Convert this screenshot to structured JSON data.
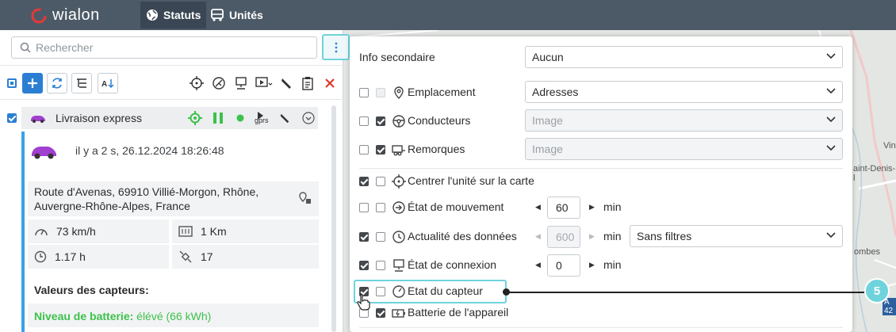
{
  "topbar": {
    "logo_text": "wialon",
    "tabs": [
      {
        "label": "Statuts",
        "icon": "globe-icon",
        "active": true
      },
      {
        "label": "Unités",
        "icon": "bus-icon",
        "active": false
      }
    ]
  },
  "search": {
    "placeholder": "Rechercher"
  },
  "unit": {
    "name": "Livraison express",
    "last_update": "il y a 2 s, 26.12.2024 18:26:48",
    "address_line1": "Route d'Avenas, 69910 Villié-Morgon, Rhône,",
    "address_line2": "Auvergne-Rhône-Alpes, France",
    "speed": "73 km/h",
    "mileage": "1 Km",
    "duration": "1.17 h",
    "satellites": "17",
    "sensors_title": "Valeurs des capteurs:",
    "battery_label": "Niveau de batterie:",
    "battery_value": "élévé (66 kWh)",
    "gprs_label": "gprs"
  },
  "popup": {
    "secondary_info_label": "Info secondaire",
    "secondary_info_value": "Aucun",
    "location_label": "Emplacement",
    "location_value": "Adresses",
    "drivers_label": "Conducteurs",
    "drivers_value": "Image",
    "trailers_label": "Remorques",
    "trailers_value": "Image",
    "center_label": "Centrer l'unité sur la carte",
    "movement_label": "État de mouvement",
    "movement_value": "60",
    "freshness_label": "Actualité des données",
    "freshness_value": "600",
    "freshness_filter": "Sans filtres",
    "connection_label": "État de connexion",
    "connection_value": "0",
    "sensor_state_label": "Etat du capteur",
    "battery_label": "Batterie de l'appareil",
    "min_unit": "min"
  },
  "map": {
    "labels": [
      "Vin",
      "aint-Denis-l",
      "ombes",
      "A 42"
    ]
  },
  "callout": {
    "number": "5"
  },
  "colors": {
    "topbar": "#4c5a68",
    "accent": "#2b7fd3",
    "highlight": "#6fd3dc",
    "green": "#3cc24b",
    "red": "#e0392b"
  }
}
